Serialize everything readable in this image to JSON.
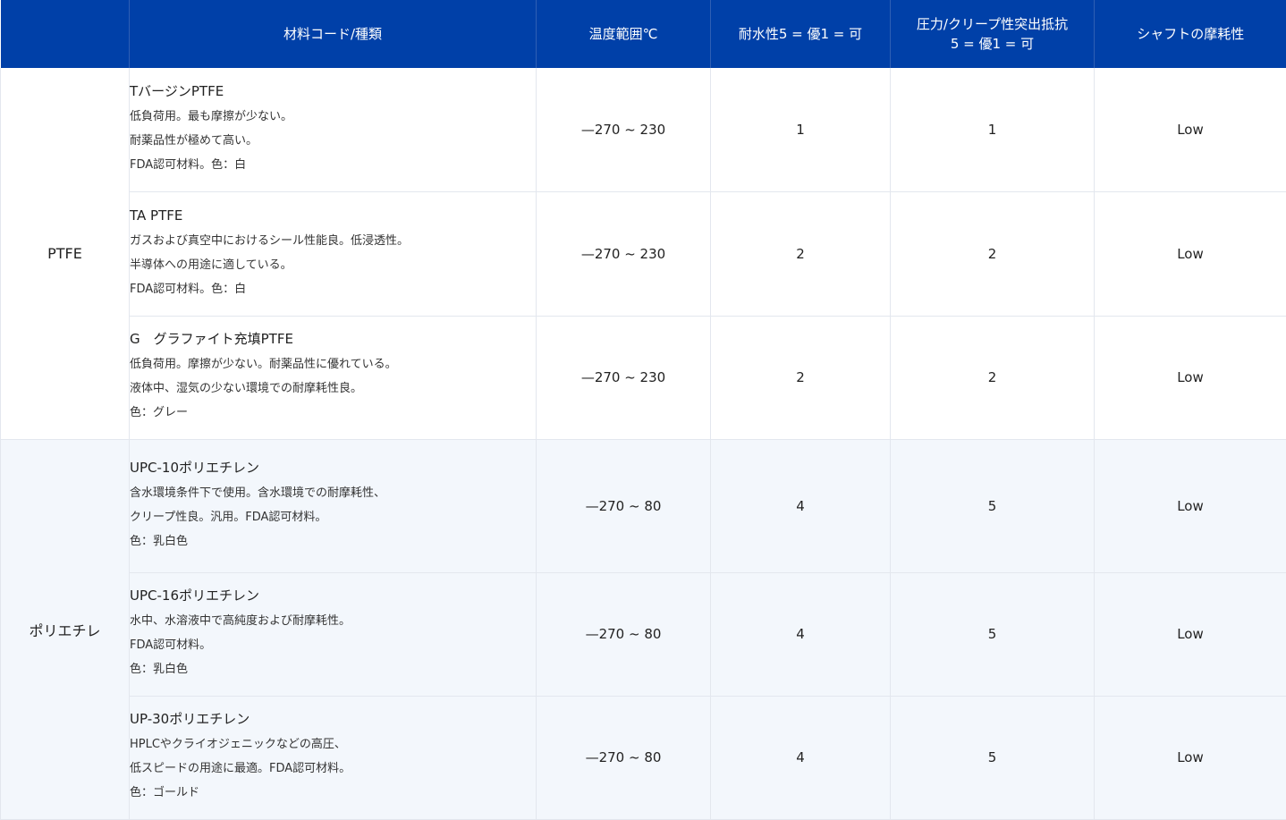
{
  "headers": {
    "material": "材料コード/種類",
    "temperature": "温度範囲℃",
    "water_resistance": "耐水性5 = 優1 = 可",
    "pressure_line1": "圧力/クリープ性突出抵抗",
    "pressure_line2": "5 = 優1 = 可",
    "shaft_wear": "シャフトの摩耗性"
  },
  "groups": [
    {
      "name": "PTFE",
      "rows": [
        {
          "name": "TバージンPTFE",
          "lines": [
            "低負荷用。最も摩擦が少ない。",
            "耐薬品性が極めて高い。",
            "FDA認可材料。色：白"
          ],
          "temperature": "—270 ~ 230",
          "water": "1",
          "pressure": "1",
          "wear": "Low"
        },
        {
          "name": "TA PTFE",
          "lines": [
            "ガスおよび真空中におけるシール性能良。低浸透性。",
            "半導体への用途に適している。",
            "FDA認可材料。色：白"
          ],
          "temperature": "—270 ~ 230",
          "water": "2",
          "pressure": "2",
          "wear": "Low"
        },
        {
          "name": "G　グラファイト充填PTFE",
          "lines": [
            "低負荷用。摩擦が少ない。耐薬品性に優れている。",
            "液体中、湿気の少ない環境での耐摩耗性良。",
            "色：グレー"
          ],
          "temperature": "—270 ~ 230",
          "water": "2",
          "pressure": "2",
          "wear": "Low"
        }
      ]
    },
    {
      "name": "ポリエチレ",
      "rows": [
        {
          "name": "UPC-10ポリエチレン",
          "lines": [
            "含水環境条件下で使用。含水環境での耐摩耗性、",
            "クリープ性良。汎用。FDA認可材料。",
            "色：乳白色"
          ],
          "temperature": "—270 ~ 80",
          "water": "4",
          "pressure": "5",
          "wear": "Low"
        },
        {
          "name": "UPC-16ポリエチレン",
          "lines": [
            "水中、水溶液中で高純度および耐摩耗性。",
            "FDA認可材料。",
            "色：乳白色"
          ],
          "temperature": "—270 ~ 80",
          "water": "4",
          "pressure": "5",
          "wear": "Low"
        },
        {
          "name": "UP-30ポリエチレン",
          "lines": [
            "HPLCやクライオジェニックなどの高圧、",
            "低スピードの用途に最適。FDA認可材料。",
            "色：ゴールド"
          ],
          "temperature": "—270 ~ 80",
          "water": "4",
          "pressure": "5",
          "wear": "Low"
        }
      ]
    }
  ]
}
